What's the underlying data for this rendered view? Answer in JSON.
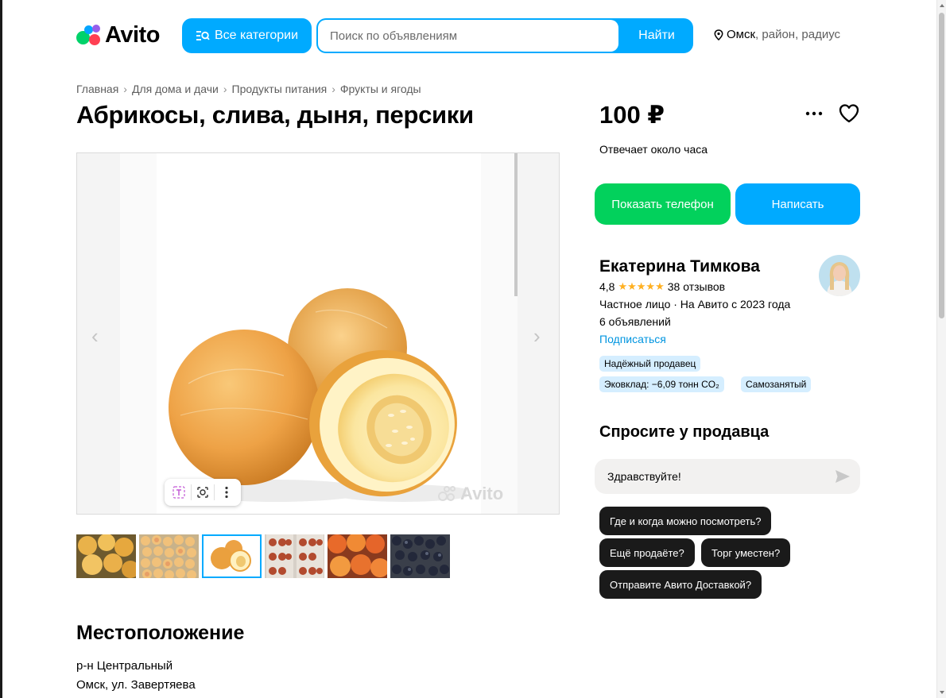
{
  "header": {
    "logo_text": "Avito",
    "categories_label": "Все категории",
    "search_placeholder": "Поиск по объявлениям",
    "search_button": "Найти",
    "location_city": "Омск",
    "location_rest": ", район, радиус"
  },
  "breadcrumb": [
    {
      "label": "Главная"
    },
    {
      "label": "Для дома и дачи"
    },
    {
      "label": "Продукты питания"
    },
    {
      "label": "Фрукты и ягоды"
    }
  ],
  "listing": {
    "title": "Абрикосы, слива, дыня, персики",
    "price": "100 ₽",
    "response_time": "Отвечает около часа",
    "show_phone_label": "Показать телефон",
    "write_label": "Написать",
    "watermark": "Avito",
    "thumbnail_count": 6,
    "active_thumbnail": 3
  },
  "seller": {
    "name": "Екатерина Тимкова",
    "rating": "4,8",
    "stars": "★★★★★",
    "reviews": "38 отзывов",
    "type": "Частное лицо · На Авито с 2023 года",
    "ads_count": "6 объявлений",
    "subscribe": "Подписаться",
    "badges": [
      "Надёжный продавец",
      "Эковклад: −6,09 тонн CO₂",
      "Самозанятый"
    ]
  },
  "ask": {
    "title": "Спросите у продавца",
    "message_value": "Здравствуйте!",
    "quick_questions": [
      "Где и когда можно посмотреть?",
      "Ещё продаёте?",
      "Торг уместен?",
      "Отправите Авито Доставкой?"
    ]
  },
  "location_section": {
    "title": "Местоположение",
    "district": "р-н Центральный",
    "address": "Омск, ул. Завертяева"
  },
  "colors": {
    "brand_blue": "#00aaff",
    "phone_green": "#02d15c",
    "badge_bg": "#d5eeff",
    "star": "#ffb021",
    "link": "#0095e0"
  },
  "icons": {
    "menu": "more-horizontal-icon",
    "favorite": "heart-icon",
    "send": "send-icon",
    "location": "location-pin-icon"
  }
}
